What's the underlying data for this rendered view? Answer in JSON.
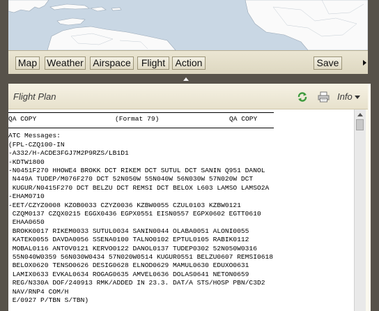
{
  "toolbar": {
    "buttons": [
      "Map",
      "Weather",
      "Airspace",
      "Flight",
      "Action"
    ],
    "save_label": "Save"
  },
  "panel": {
    "title": "Flight Plan",
    "info_label": "Info"
  },
  "flight_plan": {
    "header_left": "QA COPY",
    "header_center": "(Format 79)",
    "header_right": "QA COPY",
    "messages_label": "ATC Messages:",
    "lines": [
      "(FPL-CZQ100-IN",
      "-A332/H-ACDE3FGJ7M2P9RZS/LB1D1",
      "-KDTW1800",
      "-N0451F270 HHOWE4 BROKK DCT RIKEM DCT SUTUL DCT SANIN Q951 DANOL",
      " N449A TUDEP/M076F270 DCT 52N050W 55N040W 56N030W 57N020W DCT",
      " KUGUR/N0415F270 DCT BELZU DCT REMSI DCT BELOX L603 LAMSO LAMSO2A",
      "-EHAM0710",
      "-EET/CZYZ0008 KZOB0033 CZYZ0036 KZBW0055 CZUL0103 KZBW0121",
      " CZQM0137 CZQX0215 EGGX0436 EGPX0551 EISN0557 EGPX0602 EGTT0610",
      " EHAA0650",
      " BROKK0017 RIKEM0033 SUTUL0034 SANIN0044 OLABA0051 ALONI0055",
      " KATEK0055 DAVDA0056 SSENA0100 TALNO0102 EPTUL0105 RABIK0112",
      " MOBAL0116 ANTOV0121 KERVO0122 DANOL0137 TUDEP0302 52N050W0316",
      " 55N040W0359 56N030W0434 57N020W0514 KUGUR0551 BELZU0607 REMSI0618",
      " BELOX0620 TENSO0626 DESIG0628 ELNOD0629 MAMUL0630 EDUXO0631",
      " LAMIX0633 EVKAL0634 ROGAG0635 AMVEL0636 DOLAS0641 NETON0659",
      " REG/N330A DOF/240913 RMK/ADDED IN 23.3. DAT/A STS/HOSP PBN/C3D2",
      " NAV/RNP4 COM/H",
      " E/0927 P/TBN S/TBN)"
    ]
  },
  "colors": {
    "frame": "#57524a",
    "toolbar": "#e4dfc9",
    "panel_header": "#eee9d6",
    "content_bg": "#ffffff",
    "map_water": "#c9d7e4",
    "map_land": "#fafafa",
    "refresh_green": "#3c9a3c"
  },
  "icons": [
    "refresh-icon",
    "print-icon",
    "chevron-down-icon",
    "chevron-right-icon",
    "collapse-up-icon",
    "scroll-up-icon"
  ]
}
